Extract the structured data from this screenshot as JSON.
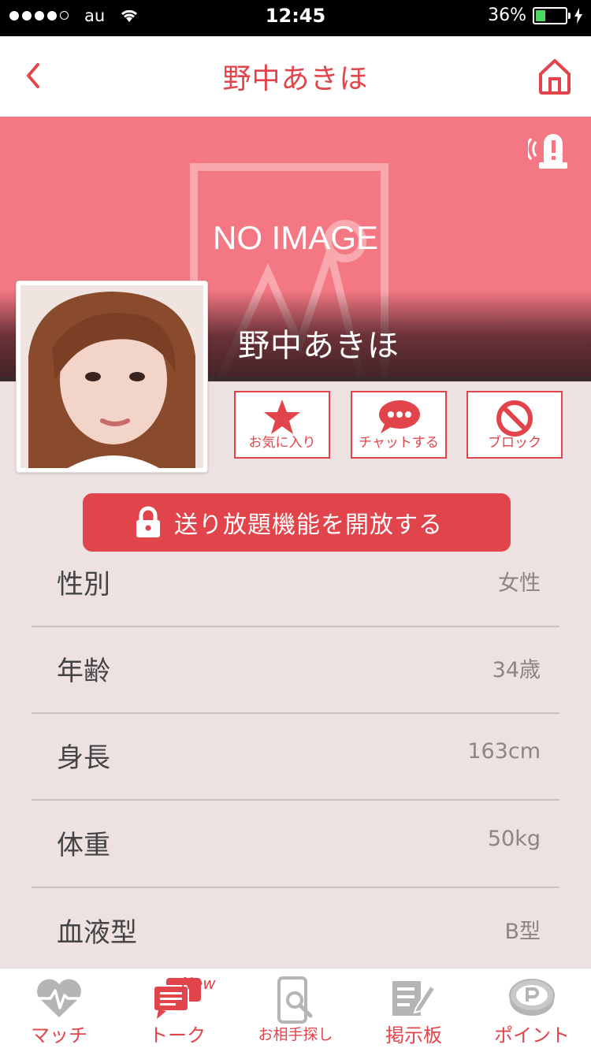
{
  "status_bar": {
    "carrier": "au",
    "time": "12:45",
    "battery_percent": "36%",
    "signal_dots_filled": 4,
    "signal_dots_total": 5
  },
  "header": {
    "title": "野中あきほ",
    "back_icon": "chevron-left-icon",
    "home_icon": "home-icon"
  },
  "banner": {
    "placeholder_text": "NO IMAGE",
    "name": "野中あきほ",
    "report_icon": "alert-siren-icon"
  },
  "actions": [
    {
      "label": "お気に入り",
      "icon": "star-icon"
    },
    {
      "label": "チャットする",
      "icon": "chat-bubble-icon"
    },
    {
      "label": "ブロック",
      "icon": "block-icon"
    }
  ],
  "unlock_button": {
    "label": "送り放題機能を開放する",
    "icon": "lock-icon"
  },
  "profile": [
    {
      "key": "性別",
      "value": "女性"
    },
    {
      "key": "年齢",
      "value": "34歳"
    },
    {
      "key": "身長",
      "value": "163cm"
    },
    {
      "key": "体重",
      "value": "50kg"
    },
    {
      "key": "血液型",
      "value": "B型"
    }
  ],
  "tabbar": {
    "new_badge": "New",
    "tabs": [
      {
        "label": "マッチ",
        "icon": "heartbeat-icon"
      },
      {
        "label": "トーク",
        "icon": "talk-bubbles-icon"
      },
      {
        "label": "お相手探し",
        "icon": "phone-search-icon"
      },
      {
        "label": "掲示板",
        "icon": "board-pen-icon"
      },
      {
        "label": "ポイント",
        "icon": "point-coin-icon"
      }
    ]
  },
  "colors": {
    "accent": "#e2444b",
    "banner": "#f37883",
    "background": "#ede1e1",
    "tab_inactive_icon": "#b5b5b5"
  }
}
